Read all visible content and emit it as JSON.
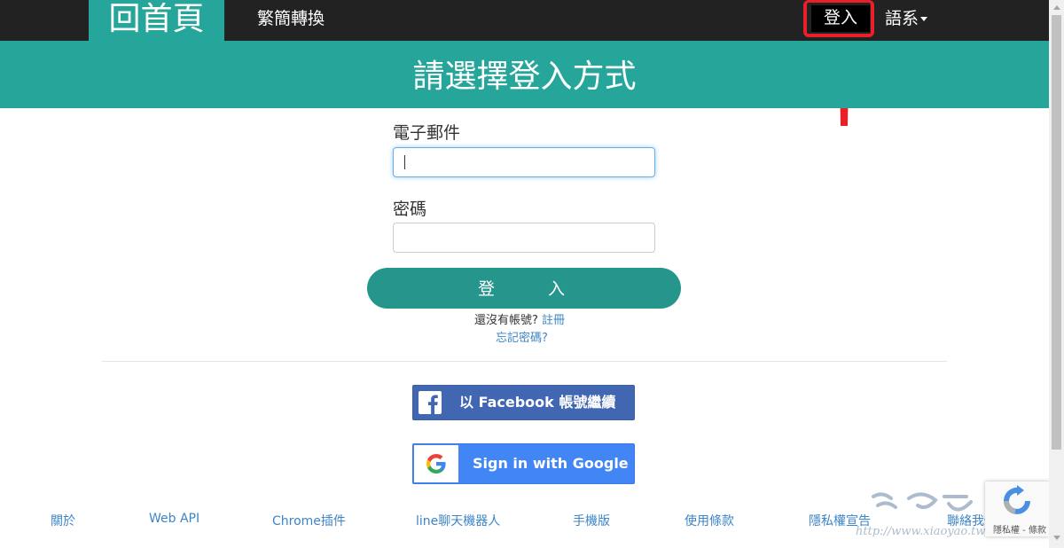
{
  "nav": {
    "home": "回首頁",
    "convert": "繁簡轉換",
    "login": "登入",
    "language": "語系"
  },
  "banner": {
    "title": "請選擇登入方式"
  },
  "form": {
    "email_label": "電子郵件",
    "email_value": "",
    "password_label": "密碼",
    "password_value": "",
    "submit": "登入",
    "no_account": "還沒有帳號?",
    "register": "註冊",
    "forgot": "忘記密碼?"
  },
  "social": {
    "facebook": "以 Facebook 帳號繼續",
    "google": "Sign in with Google"
  },
  "footer": {
    "items": [
      "關於",
      "Web API",
      "Chrome插件",
      "line聊天機器人",
      "手機版",
      "使用條款",
      "隱私權宣告",
      "聯絡我們"
    ]
  },
  "recaptcha": {
    "terms": "隱私權 - 條款"
  },
  "watermark": {
    "url": "http://www.xiaoyao.tw/"
  },
  "colors": {
    "accent": "#26a69a",
    "nav_bg": "#222222",
    "link": "#3d85c6",
    "facebook": "#4267b2",
    "google": "#4285f4",
    "highlight": "#e8202a"
  }
}
